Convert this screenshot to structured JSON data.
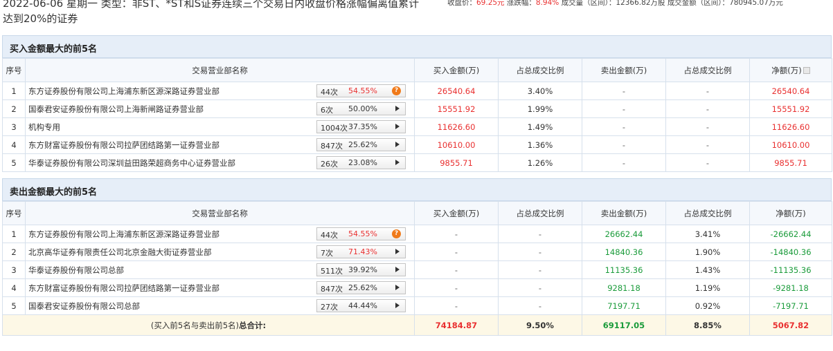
{
  "header": {
    "title": "2022-06-06 星期一 类型：非ST、*ST和S证券连续三个交易日内收盘价格涨幅偏离值累计达到20%的证券",
    "stats": {
      "close_label": "收盘价：",
      "close_value": "69.25元",
      "change_label": "涨跌幅：",
      "change_value": "8.94%",
      "volume_label": "成交量（区间）：",
      "volume_value": "12366.82万股",
      "amount_label": "成交金额（区间）：",
      "amount_value": "780945.07万元"
    }
  },
  "columns": {
    "idx": "序号",
    "name": "交易营业部名称",
    "buy_amount": "买入金额(万)",
    "buy_ratio": "占总成交比例",
    "sell_amount": "卖出金额(万)",
    "sell_ratio": "占总成交比例",
    "net": "净额(万)"
  },
  "buy_section": {
    "title": "买入金额最大的前5名",
    "rows": [
      {
        "idx": "1",
        "name": "东方证券股份有限公司上海浦东新区源深路证券营业部",
        "count": "44次",
        "pct": "54.55%",
        "pct_color": "red",
        "icon": "question-icon",
        "buy": "26540.64",
        "buy_ratio": "3.40%",
        "sell": "-",
        "sell_ratio": "-",
        "net": "26540.64"
      },
      {
        "idx": "2",
        "name": "国泰君安证券股份有限公司上海新闸路证券营业部",
        "count": "6次",
        "pct": "50.00%",
        "pct_color": "dark",
        "icon": "arrow-icon",
        "buy": "15551.92",
        "buy_ratio": "1.99%",
        "sell": "-",
        "sell_ratio": "-",
        "net": "15551.92"
      },
      {
        "idx": "3",
        "name": "机构专用",
        "count": "1004次",
        "pct": "37.35%",
        "pct_color": "dark",
        "icon": "arrow-icon",
        "buy": "11626.60",
        "buy_ratio": "1.49%",
        "sell": "-",
        "sell_ratio": "-",
        "net": "11626.60"
      },
      {
        "idx": "4",
        "name": "东方财富证券股份有限公司拉萨团结路第一证券营业部",
        "count": "847次",
        "pct": "25.62%",
        "pct_color": "dark",
        "icon": "arrow-icon",
        "buy": "10610.00",
        "buy_ratio": "1.36%",
        "sell": "-",
        "sell_ratio": "-",
        "net": "10610.00"
      },
      {
        "idx": "5",
        "name": "华泰证券股份有限公司深圳益田路荣超商务中心证券营业部",
        "count": "26次",
        "pct": "23.08%",
        "pct_color": "dark",
        "icon": "arrow-icon",
        "buy": "9855.71",
        "buy_ratio": "1.26%",
        "sell": "-",
        "sell_ratio": "-",
        "net": "9855.71"
      }
    ]
  },
  "sell_section": {
    "title": "卖出金额最大的前5名",
    "rows": [
      {
        "idx": "1",
        "name": "东方证券股份有限公司上海浦东新区源深路证券营业部",
        "count": "44次",
        "pct": "54.55%",
        "pct_color": "red",
        "icon": "question-icon",
        "buy": "-",
        "buy_ratio": "-",
        "sell": "26662.44",
        "sell_ratio": "3.41%",
        "net": "-26662.44"
      },
      {
        "idx": "2",
        "name": "北京高华证券有限责任公司北京金融大街证券营业部",
        "count": "7次",
        "pct": "71.43%",
        "pct_color": "red",
        "icon": "arrow-icon",
        "buy": "-",
        "buy_ratio": "-",
        "sell": "14840.36",
        "sell_ratio": "1.90%",
        "net": "-14840.36"
      },
      {
        "idx": "3",
        "name": "华泰证券股份有限公司总部",
        "count": "511次",
        "pct": "39.92%",
        "pct_color": "dark",
        "icon": "arrow-icon",
        "buy": "-",
        "buy_ratio": "-",
        "sell": "11135.36",
        "sell_ratio": "1.43%",
        "net": "-11135.36"
      },
      {
        "idx": "4",
        "name": "东方财富证券股份有限公司拉萨团结路第一证券营业部",
        "count": "847次",
        "pct": "25.62%",
        "pct_color": "dark",
        "icon": "arrow-icon",
        "buy": "-",
        "buy_ratio": "-",
        "sell": "9281.18",
        "sell_ratio": "1.19%",
        "net": "-9281.18"
      },
      {
        "idx": "5",
        "name": "国泰君安证券股份有限公司总部",
        "count": "27次",
        "pct": "44.44%",
        "pct_color": "dark",
        "icon": "arrow-icon",
        "buy": "-",
        "buy_ratio": "-",
        "sell": "7197.71",
        "sell_ratio": "0.92%",
        "net": "-7197.71"
      }
    ]
  },
  "total": {
    "label_prefix": "(买入前5名与卖出前5名)",
    "label_bold": "总合计:",
    "buy": "74184.87",
    "buy_ratio": "9.50%",
    "sell": "69117.05",
    "sell_ratio": "8.85%",
    "net": "5067.82"
  },
  "colors": {
    "red": "#e93030",
    "green": "#1a9b3a",
    "section_bg": "#e6eef8",
    "total_bg": "#fdf8e6"
  }
}
